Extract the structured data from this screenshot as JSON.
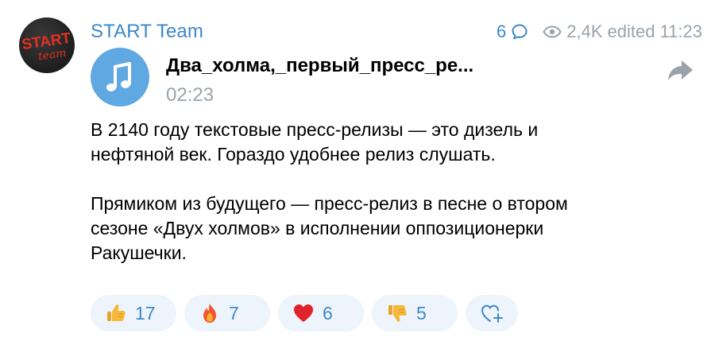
{
  "channel": {
    "name": "START Team",
    "logo_text_top": "START",
    "logo_text_bottom": "team"
  },
  "meta": {
    "comments_count": "6",
    "views": "2,4K",
    "edited_time": "edited 11:23"
  },
  "audio": {
    "title": "Два_холма,_первый_пресс_ре...",
    "duration": "02:23"
  },
  "message": {
    "paragraph_1": "В 2140 году текстовые пресс-релизы — это дизель и нефтяной век. Гораздо удобнее релиз слушать.",
    "paragraph_2": "Прямиком из будущего — пресс-релиз в песне о втором сезоне «Двух холмов» в исполнении оппозиционерки Ракушечки."
  },
  "reactions": [
    {
      "emoji": "thumbs-up",
      "count": "17"
    },
    {
      "emoji": "fire",
      "count": "7"
    },
    {
      "emoji": "red-heart",
      "count": "6"
    },
    {
      "emoji": "thumbs-down",
      "count": "5"
    }
  ],
  "colors": {
    "accent": "#3e88c8",
    "muted": "#9aa3ab",
    "audio_button": "#5fa8e2",
    "reaction_bg": "#eef4fb",
    "logo_red": "#e2301f"
  }
}
